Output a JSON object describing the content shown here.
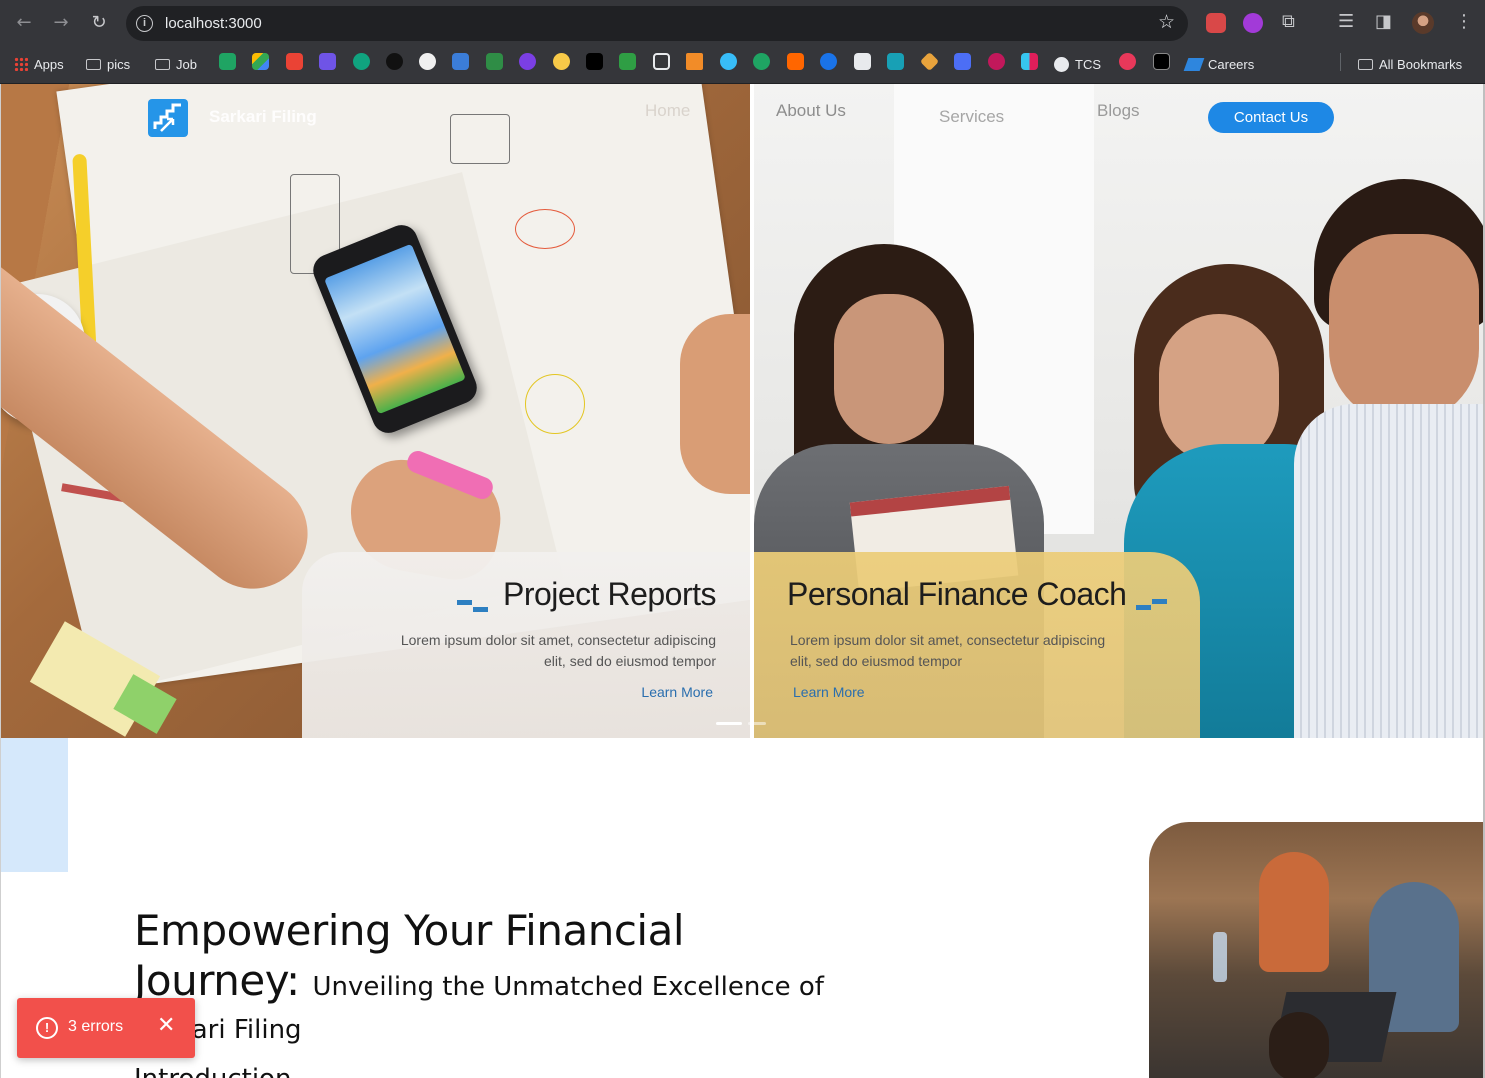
{
  "browser": {
    "url": "localhost:3000",
    "nav": {
      "back_icon": "←",
      "forward_icon": "→",
      "reload_icon": "↻"
    },
    "toolbar_icons": [
      "star-icon",
      "extensions-icon",
      "reading-list-icon",
      "side-panel-icon",
      "profile-avatar",
      "kebab-menu-icon"
    ],
    "bookmarks": {
      "apps_label": "Apps",
      "folders": [
        "pics",
        "Job"
      ],
      "tcs_label": "TCS",
      "careers_label": "Careers",
      "all_bookmarks_label": "All Bookmarks"
    }
  },
  "site": {
    "brand": "Sarkari Filing",
    "nav": {
      "home": "Home",
      "about": "About Us",
      "services": "Services",
      "blogs": "Blogs",
      "contact": "Contact Us"
    },
    "slides": [
      {
        "title": "Project Reports",
        "body": "Lorem ipsum dolor sit amet, consectetur adipiscing elit, sed do eiusmod tempor",
        "link": "Learn More"
      },
      {
        "title": "Personal Finance Coach",
        "body": "Lorem ipsum dolor sit amet, consectetur adipiscing elit, sed do eiusmod tempor",
        "link": "Learn More"
      }
    ],
    "intro": {
      "heading_line1": "Empowering Your Financial",
      "heading_line2": "Journey:",
      "heading_sub": "Unveiling the Unmatched Excellence of",
      "heading_line3": "Sarkari Filing",
      "section_label": "Introduction"
    }
  },
  "error_toast": {
    "text": "3 errors",
    "icon": "!",
    "close": "✕"
  },
  "colors": {
    "accent": "#1e88e5",
    "toast": "#f2504b",
    "chrome_bg": "#35363a"
  }
}
